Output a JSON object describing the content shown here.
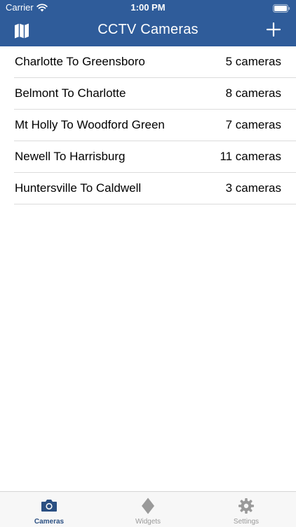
{
  "status_bar": {
    "carrier": "Carrier",
    "time": "1:00 PM"
  },
  "nav": {
    "title": "CCTV Cameras",
    "left_icon": "map-icon",
    "right_icon": "plus-icon"
  },
  "routes": [
    {
      "name": "Charlotte To Greensboro",
      "count": "5 cameras"
    },
    {
      "name": "Belmont To Charlotte",
      "count": "8 cameras"
    },
    {
      "name": "Mt Holly To Woodford Green",
      "count": "7 cameras"
    },
    {
      "name": "Newell To Harrisburg",
      "count": "11 cameras"
    },
    {
      "name": "Huntersville To Caldwell",
      "count": "3 cameras"
    }
  ],
  "tabs": [
    {
      "label": "Cameras",
      "icon": "camera-icon",
      "active": true
    },
    {
      "label": "Widgets",
      "icon": "diamond-icon",
      "active": false
    },
    {
      "label": "Settings",
      "icon": "gear-icon",
      "active": false
    }
  ],
  "colors": {
    "nav_background": "#2f5c9a",
    "tab_active": "#2a4f82",
    "tab_inactive": "#999999"
  }
}
